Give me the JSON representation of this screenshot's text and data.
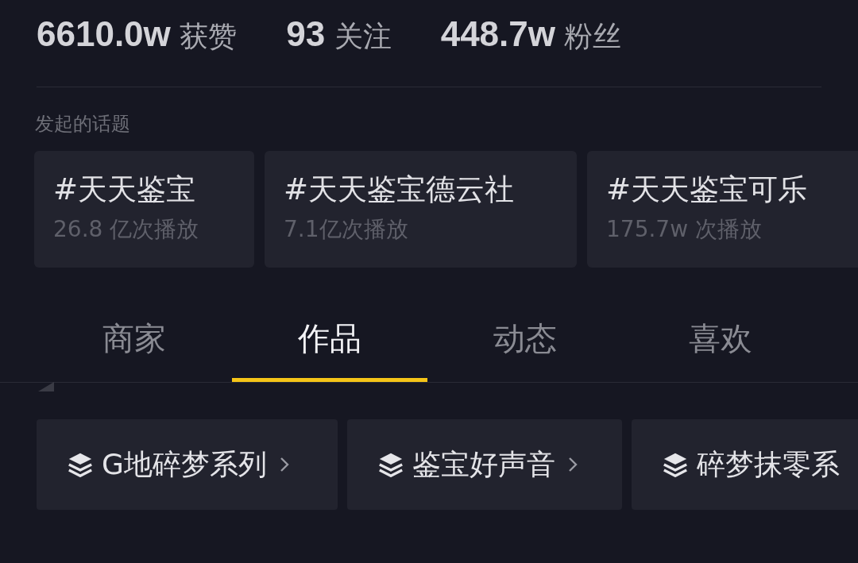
{
  "stats": [
    "**6610.0w** 获赞",
    "**93** 关注",
    "**448.7w** 粉丝"
  ],
  "section_title": "发起的话题",
  "topics": [
    {
      "title": "#天天鉴宝",
      "plays": "26.8 亿次播放"
    },
    {
      "title": "#天天鉴宝德云社",
      "plays": "7.1亿次播放"
    },
    {
      "title": "#天天鉴宝可乐",
      "plays": "175.7w 次播放"
    }
  ],
  "tabs": [
    {
      "label": "商家",
      "selected": false
    },
    {
      "label": "作品",
      "selected": true
    },
    {
      "label": "动态",
      "selected": false
    },
    {
      "label": "喜欢",
      "selected": false
    }
  ],
  "collections": [
    {
      "label": "G地碎梦系列",
      "chevron": true
    },
    {
      "label": "鉴宝好声音",
      "chevron": true
    },
    {
      "label": "碎梦抹零系",
      "chevron": false
    }
  ]
}
